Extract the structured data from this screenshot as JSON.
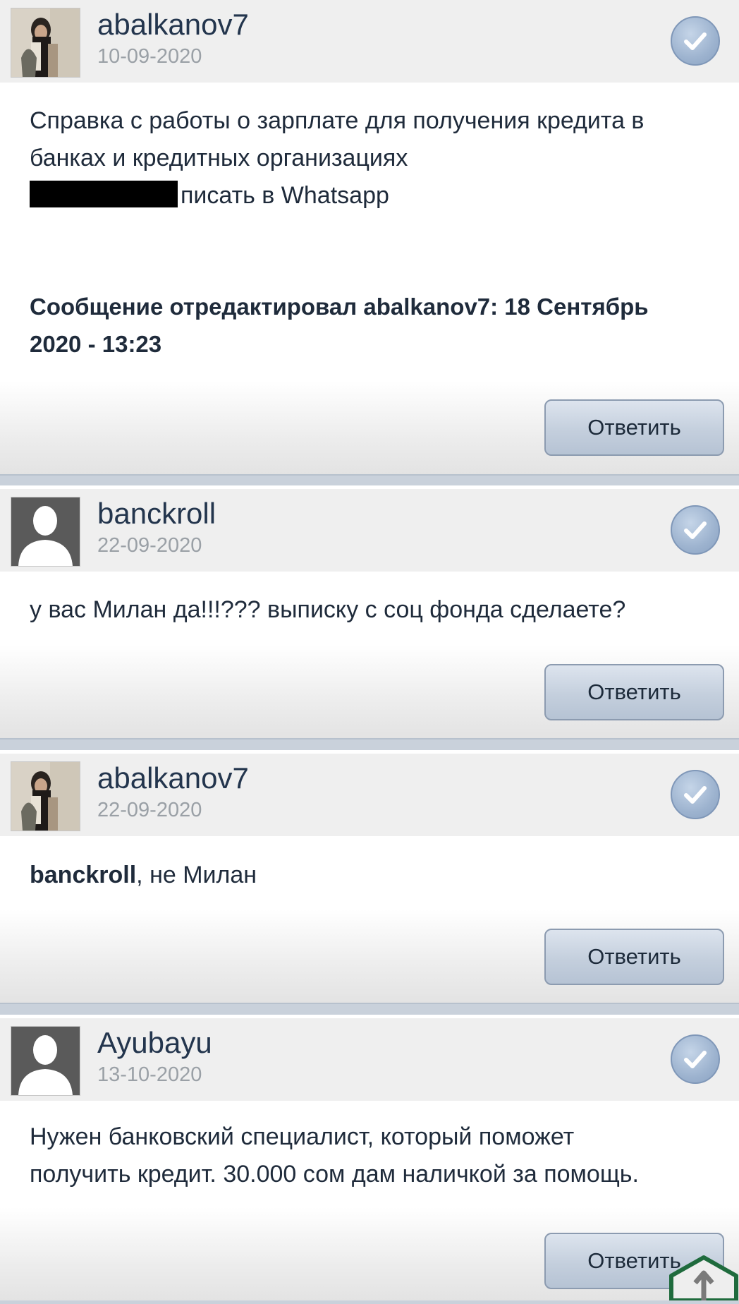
{
  "posts": [
    {
      "username": "abalkanov7",
      "date": "10-09-2020",
      "avatar": "user-photo",
      "text_line1": "Справка с работы о зарплате для получения кредита в",
      "text_line2": "банках и кредитных организациях",
      "text_line3": "писать в Whatsapp",
      "edited_line1": "Сообщение отредактировал abalkanov7: 18 Сентябрь",
      "edited_line2": "2020 - 13:23",
      "reply_label": "Ответить"
    },
    {
      "username": "banckroll",
      "date": "22-09-2020",
      "avatar": "default-silhouette",
      "text_line1": "у вас Милан да!!!??? выписку с соц фонда сделаете?",
      "reply_label": "Ответить"
    },
    {
      "username": "abalkanov7",
      "date": "22-09-2020",
      "avatar": "user-photo",
      "mention": "banckroll",
      "text_after_mention": ", не Милан",
      "reply_label": "Ответить"
    },
    {
      "username": "Ayubayu",
      "date": "13-10-2020",
      "avatar": "default-silhouette",
      "text_line1": "Нужен банковский специалист, который поможет",
      "text_line2": "получить кредит. 30.000 сом дам наличкой за помощь.",
      "reply_label": "Ответить"
    }
  ],
  "icons": {
    "check": "check-icon",
    "scroll_top": "arrow-up-icon"
  },
  "colors": {
    "header_bg": "#efefef",
    "username": "#23354d",
    "date": "#9aa0a6",
    "button_bg": "#c4cfdd",
    "scroll_accent": "#1f6b3d"
  }
}
